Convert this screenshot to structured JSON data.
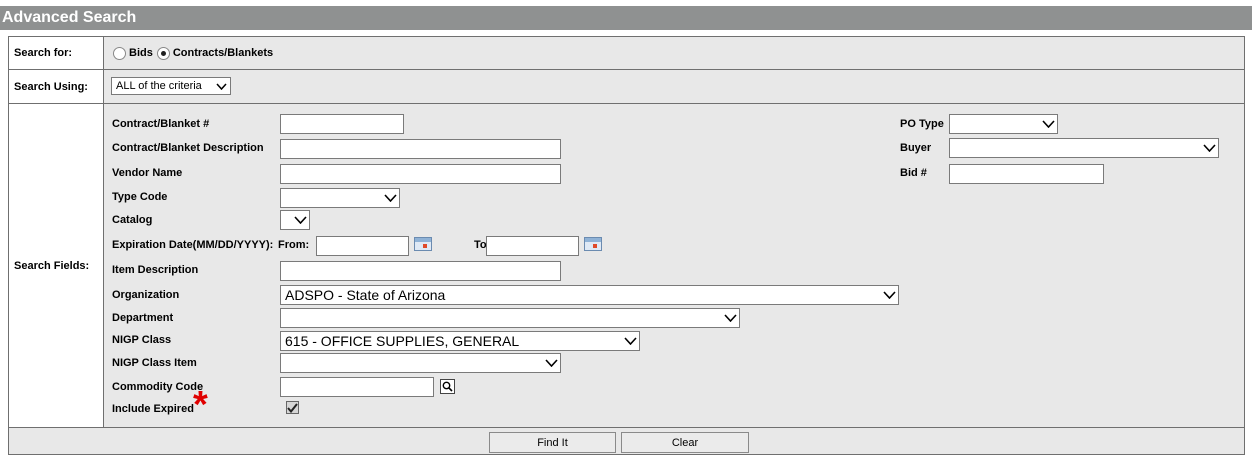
{
  "title": "Advanced Search",
  "search_for": {
    "label": "Search for:",
    "options": [
      {
        "label": "Bids",
        "selected": false
      },
      {
        "label": "Contracts/Blankets",
        "selected": true
      }
    ]
  },
  "search_using": {
    "label": "Search Using:",
    "value": "ALL of the criteria"
  },
  "search_fields": {
    "label": "Search Fields:",
    "contract_number": {
      "label": "Contract/Blanket #",
      "value": ""
    },
    "contract_description": {
      "label": "Contract/Blanket Description",
      "value": ""
    },
    "vendor_name": {
      "label": "Vendor Name",
      "value": ""
    },
    "type_code": {
      "label": "Type Code",
      "value": ""
    },
    "catalog": {
      "label": "Catalog",
      "value": ""
    },
    "expiration": {
      "label": "Expiration Date(MM/DD/YYYY):",
      "from_label": "From:",
      "to_label": "To",
      "from_value": "",
      "to_value": ""
    },
    "item_description": {
      "label": "Item Description",
      "value": ""
    },
    "organization": {
      "label": "Organization",
      "value": "ADSPO - State of Arizona"
    },
    "department": {
      "label": "Department",
      "value": ""
    },
    "nigp_class": {
      "label": "NIGP Class",
      "value": "615 - OFFICE SUPPLIES, GENERAL"
    },
    "nigp_class_item": {
      "label": "NIGP Class Item",
      "value": ""
    },
    "commodity_code": {
      "label": "Commodity Code",
      "value": ""
    },
    "include_expired": {
      "label": "Include Expired",
      "checked": true,
      "marker": "*"
    },
    "po_type": {
      "label": "PO Type",
      "value": ""
    },
    "buyer": {
      "label": "Buyer",
      "value": ""
    },
    "bid_number": {
      "label": "Bid #",
      "value": ""
    }
  },
  "buttons": {
    "find": "Find It",
    "clear": "Clear"
  },
  "colors": {
    "title_bar": "#8f9191",
    "panel": "#e8e8e8",
    "asterisk": "#e00000"
  }
}
